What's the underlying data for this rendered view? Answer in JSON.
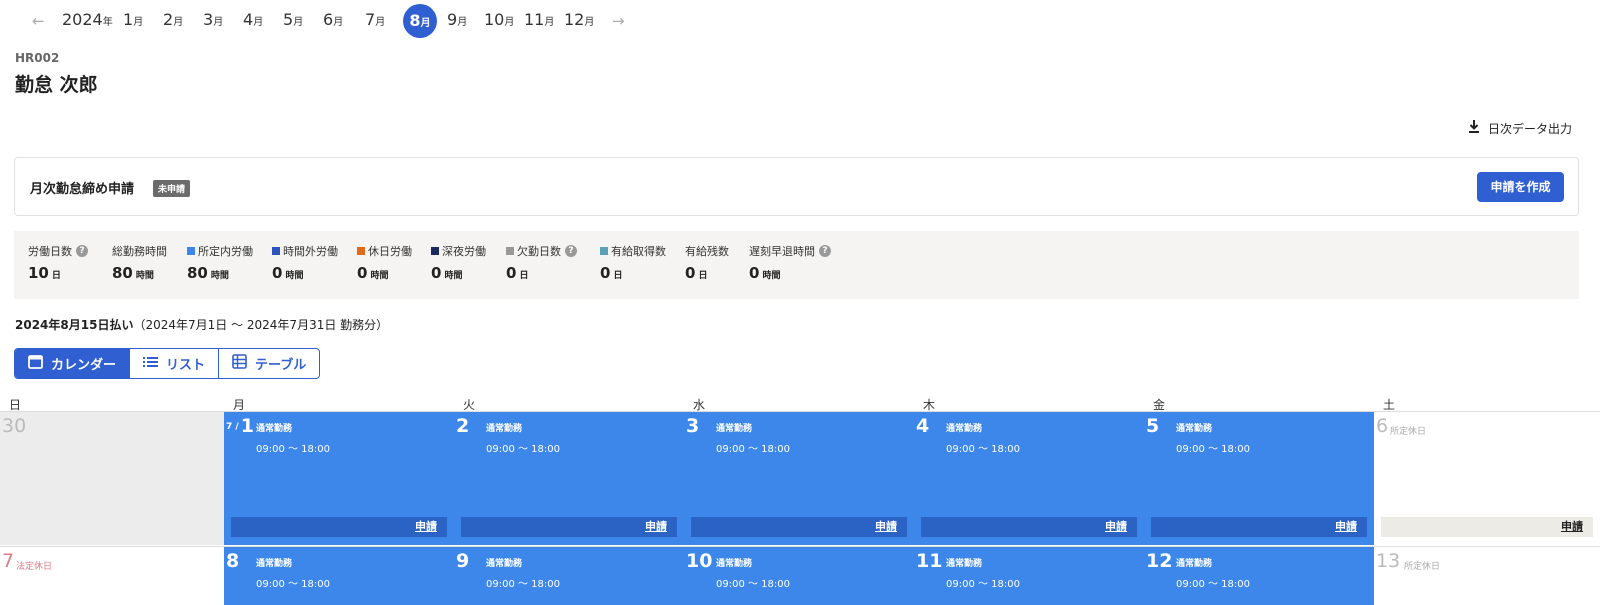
{
  "nav": {
    "prev": "←",
    "next": "→",
    "year": "2024",
    "year_unit": "年",
    "month_unit": "月",
    "months": [
      "1",
      "2",
      "3",
      "4",
      "5",
      "6",
      "7",
      "8",
      "9",
      "10",
      "11",
      "12"
    ],
    "selected_month": "8"
  },
  "employee": {
    "code": "HR002",
    "name": "勤怠 次郎"
  },
  "export_label": "日次データ出力",
  "closing": {
    "title": "月次勤怠締め申請",
    "status": "未申請",
    "button": "申請を作成"
  },
  "stats": [
    {
      "label": "労働日数",
      "value": "10",
      "unit": "日",
      "help": true
    },
    {
      "label": "総勤務時間",
      "value": "80",
      "unit": "時間"
    },
    {
      "label": "所定内労働",
      "value": "80",
      "unit": "時間",
      "color": "#3d87eb"
    },
    {
      "label": "時間外労働",
      "value": "0",
      "unit": "時間",
      "color": "#2b55b8"
    },
    {
      "label": "休日労働",
      "value": "0",
      "unit": "時間",
      "color": "#e06a1a"
    },
    {
      "label": "深夜労働",
      "value": "0",
      "unit": "時間",
      "color": "#1a2a5e"
    },
    {
      "label": "欠勤日数",
      "value": "0",
      "unit": "日",
      "color": "#999999",
      "help": true
    },
    {
      "label": "有給取得数",
      "value": "0",
      "unit": "日",
      "color": "#5aa0b8"
    },
    {
      "label": "有給残数",
      "value": "0",
      "unit": "日"
    },
    {
      "label": "遅刻早退時間",
      "value": "0",
      "unit": "時間",
      "help": true
    }
  ],
  "help_icon": "?",
  "pay": {
    "date": "2024年8月15日払い",
    "period": "（2024年7月1日 ～ 2024年7月31日 勤務分）"
  },
  "views": [
    {
      "label": "カレンダー",
      "icon": "calendar-icon",
      "active": true
    },
    {
      "label": "リスト",
      "icon": "list-icon"
    },
    {
      "label": "テーブル",
      "icon": "table-icon"
    }
  ],
  "weekdays": [
    "日",
    "月",
    "火",
    "水",
    "木",
    "金",
    "土"
  ],
  "work_type": "通常勤務",
  "work_time": "09:00 ～ 18:00",
  "apply_label": "申請",
  "week1": [
    {
      "day": "30",
      "kind": "gray"
    },
    {
      "day": "1",
      "kind": "work",
      "prefix": "7 /"
    },
    {
      "day": "2",
      "kind": "work"
    },
    {
      "day": "3",
      "kind": "work"
    },
    {
      "day": "4",
      "kind": "work"
    },
    {
      "day": "5",
      "kind": "work"
    },
    {
      "day": "6",
      "kind": "sat",
      "type": "所定休日"
    }
  ],
  "week2": [
    {
      "day": "7",
      "kind": "sun",
      "type": "法定休日"
    },
    {
      "day": "8",
      "kind": "work"
    },
    {
      "day": "9",
      "kind": "work"
    },
    {
      "day": "10",
      "kind": "work"
    },
    {
      "day": "11",
      "kind": "work"
    },
    {
      "day": "12",
      "kind": "work"
    },
    {
      "day": "13",
      "kind": "sat",
      "type": "所定休日"
    }
  ]
}
